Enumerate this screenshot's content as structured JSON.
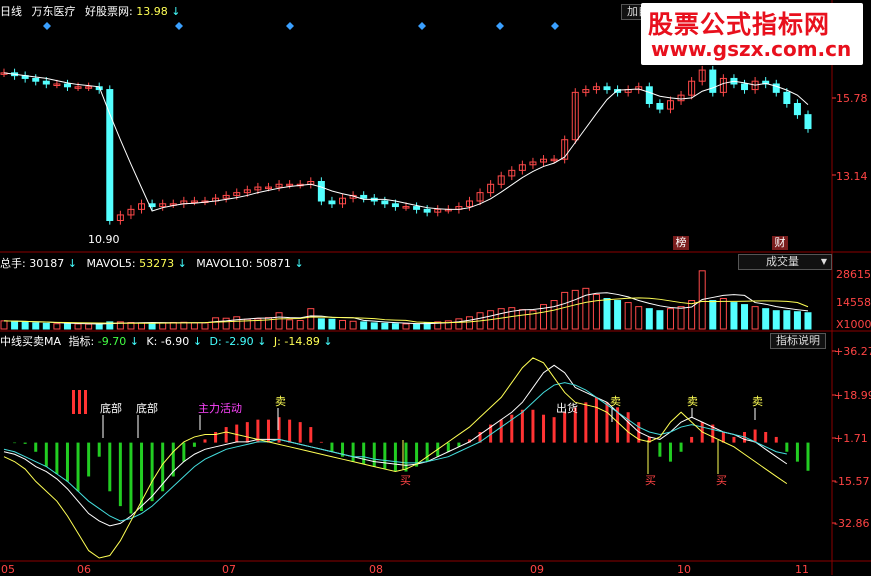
{
  "colors": {
    "up": "#ff4a4a",
    "down": "#54ffff",
    "ma": "#ffffff",
    "yellow": "#ffff55",
    "cyan": "#44dddd",
    "green": "#22cc22",
    "red": "#ff3333",
    "magenta": "#ff44ff",
    "grid": "#8b0000",
    "axis": "#ff3333"
  },
  "price_panel": {
    "header_period": "日线",
    "header_stock": "万东医疗",
    "header_label": "好股票网:",
    "header_value": "13.98",
    "axis_labels": [
      "15.78",
      "13.14"
    ],
    "low_label": "10.90",
    "top_button": "加自",
    "marker_bang": "榜",
    "marker_cai": "财"
  },
  "volume_panel": {
    "label_total": "总手:",
    "value_total": "30187",
    "label_mavol5": "MAVOL5:",
    "value_mavol5": "53273",
    "label_mavol10": "MAVOL10:",
    "value_mavol10": "50871",
    "dropdown": "成交量",
    "axis_labels": [
      "28615",
      "14558"
    ],
    "axis_unit": "X1000"
  },
  "indicator_panel": {
    "name": "中线买卖MA",
    "label_index": "指标:",
    "value_index": "-9.70",
    "label_k": "K:",
    "value_k": "-6.90",
    "label_d": "D:",
    "value_d": "-2.90",
    "label_j": "J:",
    "value_j": "-14.89",
    "help_button": "指标说明",
    "axis_labels": [
      "+36.27",
      "+18.99",
      "+1.71",
      "-15.57",
      "-32.86"
    ],
    "annotations": {
      "bottom1": "底部",
      "bottom2": "底部",
      "main_force": "主力活动",
      "sell": "卖",
      "buy": "买",
      "ship": "出货"
    }
  },
  "x_axis": {
    "labels": [
      "05",
      "06",
      "07",
      "08",
      "09",
      "10",
      "11"
    ]
  },
  "watermark": {
    "line1": "股票公式指标网",
    "line2": "www.gszx.com.cn"
  },
  "chart_data": {
    "type": "candlestick",
    "price_close": [
      16.5,
      16.4,
      16.3,
      16.2,
      16.1,
      16.1,
      16.0,
      16.0,
      16.0,
      15.9,
      11.2,
      11.4,
      11.6,
      11.8,
      11.7,
      11.8,
      11.8,
      11.9,
      11.9,
      11.9,
      12.0,
      12.1,
      12.2,
      12.3,
      12.4,
      12.4,
      12.5,
      12.5,
      12.5,
      12.6,
      11.9,
      11.8,
      12.0,
      12.1,
      12.0,
      11.9,
      11.8,
      11.7,
      11.7,
      11.6,
      11.5,
      11.6,
      11.6,
      11.7,
      11.9,
      12.2,
      12.5,
      12.8,
      13.0,
      13.2,
      13.3,
      13.4,
      13.4,
      14.1,
      15.8,
      15.9,
      16.0,
      15.9,
      15.8,
      15.9,
      16.0,
      15.4,
      15.2,
      15.5,
      15.7,
      16.2,
      16.6,
      15.8,
      16.3,
      16.1,
      15.9,
      16.2,
      16.1,
      15.8,
      15.4,
      15.0,
      14.5
    ],
    "volume_thousands": [
      4000,
      3800,
      3500,
      3000,
      2800,
      2600,
      2500,
      2500,
      2400,
      2300,
      3500,
      3500,
      3200,
      3000,
      2900,
      3000,
      3200,
      3300,
      3000,
      3000,
      5500,
      5300,
      6000,
      4800,
      5000,
      5600,
      8000,
      4500,
      4200,
      10000,
      5000,
      4800,
      4200,
      3800,
      3500,
      3000,
      2800,
      2600,
      2500,
      2400,
      3000,
      3500,
      4000,
      5000,
      6000,
      8000,
      9000,
      10000,
      10500,
      9500,
      9000,
      12000,
      14000,
      18000,
      19000,
      20000,
      17000,
      15000,
      14000,
      13000,
      11000,
      10000,
      9000,
      10000,
      11000,
      14000,
      28615,
      14000,
      15000,
      13000,
      12000,
      11000,
      10000,
      9000,
      9000,
      8500,
      8000
    ],
    "indicator_index": [
      1.7,
      1.5,
      1.2,
      -2,
      -8,
      -11,
      -14,
      -18,
      -12,
      -4,
      -18,
      -24,
      -27,
      -26,
      -22,
      -18,
      -12,
      -6,
      0,
      3,
      6,
      8,
      9,
      10,
      11,
      11,
      12,
      11,
      10,
      8,
      2,
      -2,
      -4,
      -6,
      -7,
      -8,
      -9,
      -10,
      -10,
      -8,
      -6,
      -4,
      -2,
      0,
      3,
      6,
      9,
      11,
      13,
      15,
      15,
      13,
      12,
      14,
      16,
      18,
      20,
      18,
      16,
      14,
      10,
      4,
      -4,
      -6,
      -2,
      4,
      10,
      9,
      6,
      4,
      6,
      7,
      6,
      4,
      -2,
      -6,
      -9.7
    ],
    "k_line": [
      -2,
      -3,
      -5,
      -8,
      -10,
      -13,
      -17,
      -22,
      -27,
      -30,
      -32,
      -31,
      -28,
      -24,
      -20,
      -15,
      -10,
      -6,
      -3,
      -1,
      0,
      1,
      2,
      2,
      3,
      3,
      3,
      2,
      1,
      0,
      -1,
      -2,
      -3,
      -4,
      -5,
      -6,
      -6.5,
      -7,
      -7.5,
      -7,
      -6,
      -4,
      -2,
      0,
      2,
      5,
      8,
      11,
      14,
      18,
      24,
      30,
      33,
      30,
      24,
      22,
      20,
      18,
      14,
      10,
      6,
      4,
      3,
      6,
      10,
      12,
      10,
      8,
      6,
      5,
      3,
      2,
      -1,
      -4,
      -6.9
    ],
    "d_line": [
      -1,
      -2,
      -4,
      -6,
      -8,
      -11,
      -14,
      -18,
      -22,
      -25,
      -28,
      -30,
      -29,
      -27,
      -24,
      -20,
      -16,
      -12,
      -8,
      -5,
      -3,
      -1,
      0,
      1,
      2,
      2,
      3,
      2,
      1,
      0,
      -1,
      -2,
      -3,
      -4,
      -4,
      -5,
      -5.5,
      -6,
      -6.5,
      -6.5,
      -6,
      -5,
      -4,
      -2,
      0,
      2,
      5,
      8,
      11,
      14,
      18,
      22,
      25,
      26,
      25,
      23,
      20,
      17,
      14,
      11,
      8,
      6,
      5,
      6,
      8,
      9,
      8,
      7,
      6,
      5,
      4,
      2,
      0,
      -2,
      -2.9
    ],
    "j_line": [
      -4,
      -6,
      -9,
      -14,
      -18,
      -22,
      -28,
      -35,
      -42,
      -45,
      -44,
      -38,
      -30,
      -22,
      -14,
      -7,
      -2,
      2,
      4,
      5,
      5,
      6,
      5,
      4,
      3,
      2,
      1,
      0,
      -1,
      -2,
      -3,
      -4,
      -5,
      -6,
      -7,
      -8,
      -9,
      -10,
      -9,
      -7,
      -4,
      -1,
      2,
      5,
      8,
      12,
      16,
      20,
      26,
      32,
      36,
      34,
      28,
      22,
      18,
      17,
      16,
      14,
      10,
      6,
      3,
      2,
      4,
      10,
      14,
      10,
      6,
      4,
      2,
      0,
      -3,
      -6,
      -9,
      -12,
      -14.89
    ]
  }
}
